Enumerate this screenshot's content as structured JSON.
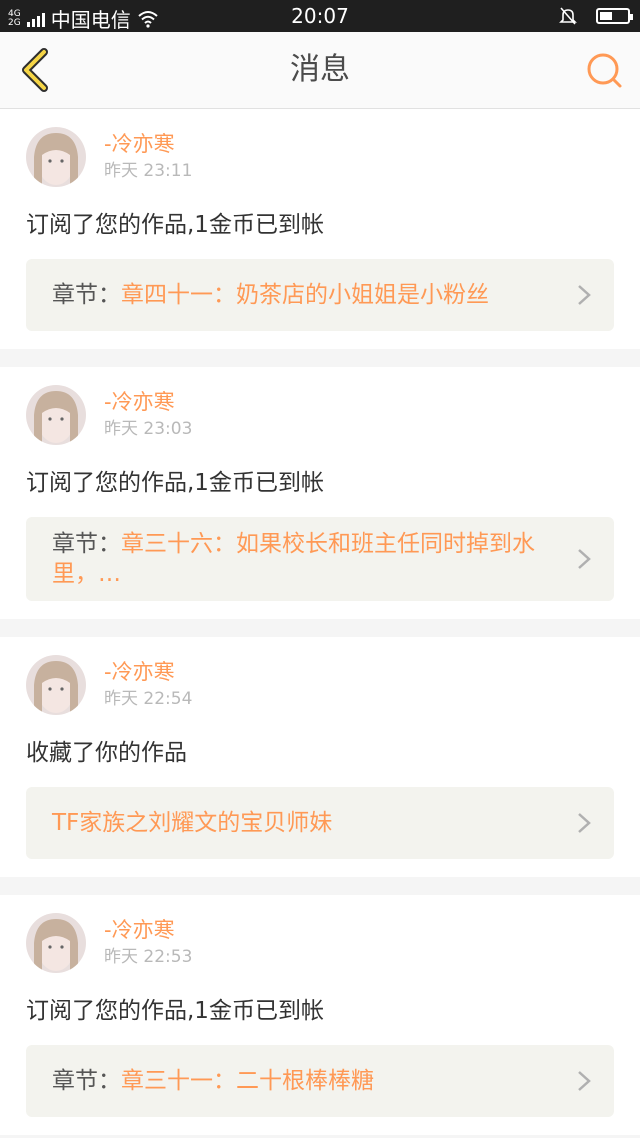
{
  "status": {
    "network": "4G",
    "network2": "2G",
    "carrier": "中国电信",
    "time": "20:07"
  },
  "header": {
    "title": "消息"
  },
  "messages": [
    {
      "user": "-冷亦寒",
      "time": "昨天 23:11",
      "text": "订阅了您的作品,1金币已到帐",
      "ref_prefix": "章节：",
      "ref_title": "章四十一：奶茶店的小姐姐是小粉丝"
    },
    {
      "user": "-冷亦寒",
      "time": "昨天 23:03",
      "text": "订阅了您的作品,1金币已到帐",
      "ref_prefix": "章节：",
      "ref_title": "章三十六：如果校长和班主任同时掉到水里，…"
    },
    {
      "user": "-冷亦寒",
      "time": "昨天 22:54",
      "text": "收藏了你的作品",
      "ref_prefix": "",
      "ref_title": "TF家族之刘耀文的宝贝师妹"
    },
    {
      "user": "-冷亦寒",
      "time": "昨天 22:53",
      "text": "订阅了您的作品,1金币已到帐",
      "ref_prefix": "章节：",
      "ref_title": "章三十一：二十根棒棒糖"
    }
  ]
}
